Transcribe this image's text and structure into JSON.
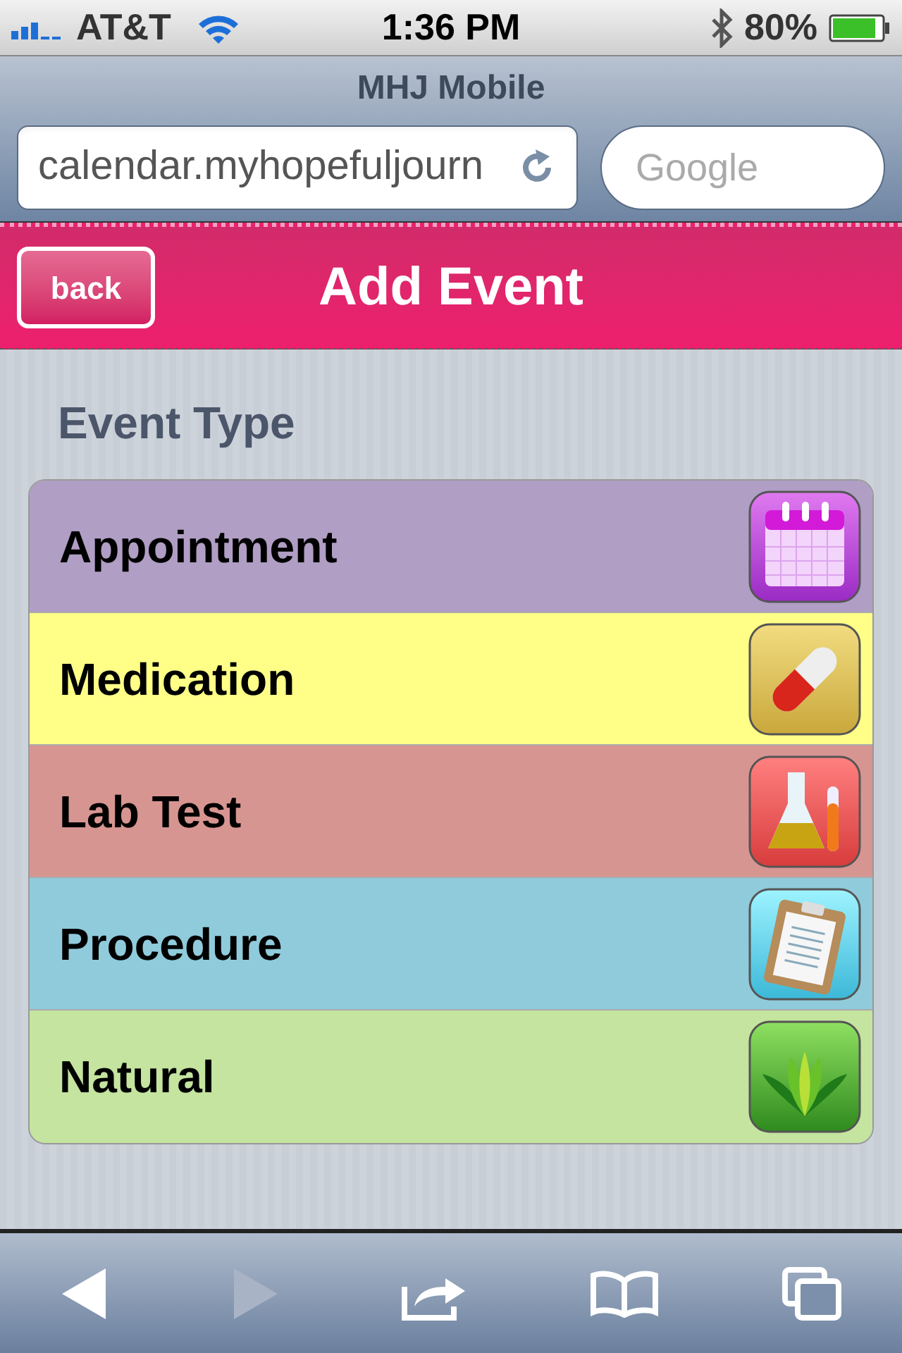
{
  "status_bar": {
    "carrier": "AT&T",
    "time": "1:36 PM",
    "battery": "80%"
  },
  "browser": {
    "title": "MHJ Mobile",
    "url": "calendar.myhopefuljourn",
    "search": {
      "placeholder": "Google"
    }
  },
  "header": {
    "back": "back",
    "title": "Add Event"
  },
  "section_title": "Event Type",
  "event_types": [
    {
      "label": "Appointment",
      "color": "#b09ec4",
      "kind": "calendar"
    },
    {
      "label": "Medication",
      "color": "#ffff88",
      "kind": "pill"
    },
    {
      "label": "Lab Test",
      "color": "#d79591",
      "kind": "flask"
    },
    {
      "label": "Procedure",
      "color": "#90cbdc",
      "kind": "clipboard"
    },
    {
      "label": "Natural",
      "color": "#c4e49f",
      "kind": "leaves"
    }
  ],
  "toolbar": {
    "back_disabled": false,
    "forward_disabled": true
  }
}
